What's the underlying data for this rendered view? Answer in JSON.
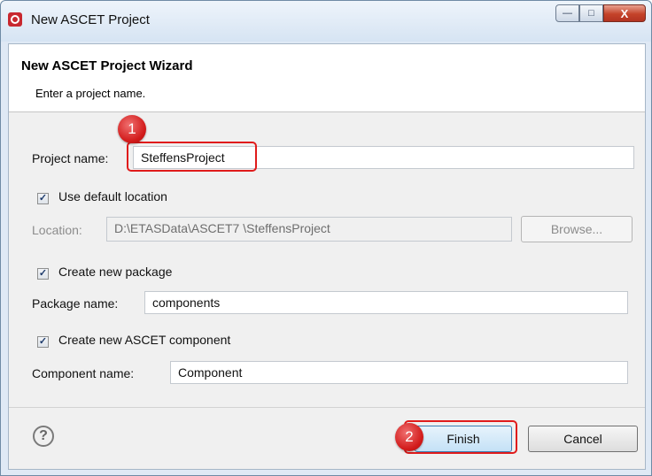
{
  "window": {
    "title": "New ASCET Project",
    "min_glyph": "—",
    "max_glyph": "□",
    "close_glyph": "X"
  },
  "wizard": {
    "title": "New ASCET Project Wizard",
    "subtitle": "Enter a project name."
  },
  "project": {
    "name_label": "Project name:",
    "name_value": "SteffensProject"
  },
  "location": {
    "use_default_label": "Use default location",
    "use_default_checked": true,
    "label": "Location:",
    "value": "D:\\ETASData\\ASCET7   \\SteffensProject",
    "browse_label": "Browse..."
  },
  "package": {
    "create_label": "Create new package",
    "create_checked": true,
    "name_label": "Package name:",
    "name_value": "components"
  },
  "component": {
    "create_label": "Create new ASCET component",
    "create_checked": true,
    "name_label": "Component name:",
    "name_value": "Component"
  },
  "footer": {
    "help_glyph": "?",
    "finish_label": "Finish",
    "cancel_label": "Cancel"
  },
  "annotations": {
    "step1": "1",
    "step2": "2",
    "color": "#e01b1b"
  },
  "icons": [
    "app-icon",
    "minimize-icon",
    "maximize-icon",
    "close-icon",
    "help-icon",
    "checkbox-checked-icon"
  ],
  "check_glyph": "✓"
}
